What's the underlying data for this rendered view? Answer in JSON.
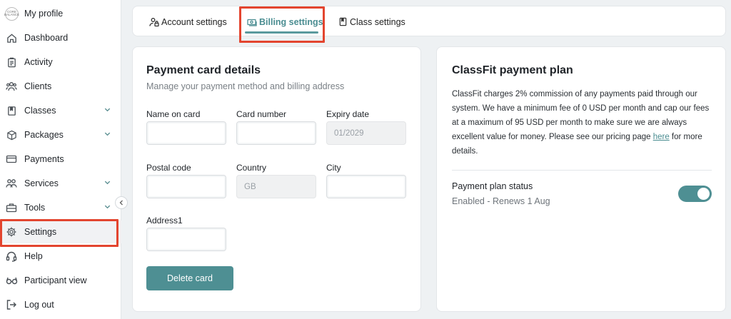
{
  "sidebar": {
    "avatar_text": "CORE BALANCE",
    "items": [
      {
        "label": "My profile"
      },
      {
        "label": "Dashboard"
      },
      {
        "label": "Activity"
      },
      {
        "label": "Clients"
      },
      {
        "label": "Classes"
      },
      {
        "label": "Packages"
      },
      {
        "label": "Payments"
      },
      {
        "label": "Services"
      },
      {
        "label": "Tools"
      },
      {
        "label": "Settings"
      },
      {
        "label": "Help"
      },
      {
        "label": "Participant view"
      },
      {
        "label": "Log out"
      }
    ]
  },
  "tabs": [
    {
      "label": "Account settings"
    },
    {
      "label": "Billing settings"
    },
    {
      "label": "Class settings"
    }
  ],
  "payment_card": {
    "title": "Payment card details",
    "subtitle": "Manage your payment method and billing address",
    "fields": {
      "name_on_card": {
        "label": "Name on card",
        "value": ""
      },
      "card_number": {
        "label": "Card number",
        "value": ""
      },
      "expiry_date": {
        "label": "Expiry date",
        "value": "01/2029"
      },
      "postal_code": {
        "label": "Postal code",
        "value": ""
      },
      "country": {
        "label": "Country",
        "value": "GB"
      },
      "city": {
        "label": "City",
        "value": ""
      },
      "address1": {
        "label": "Address1",
        "value": ""
      }
    },
    "delete_button": "Delete card"
  },
  "plan": {
    "title": "ClassFit payment plan",
    "description_before_link": "ClassFit charges 2% commission of any payments paid through our system. We have a minimum fee of 0 USD per month and cap our fees at a maximum of 95 USD per month to make sure we are always excellent value for money. Please see our pricing page ",
    "link_text": "here",
    "description_after_link": " for more details.",
    "status_label": "Payment plan status",
    "status_value": "Enabled - Renews 1 Aug",
    "toggle_on": true
  },
  "colors": {
    "accent": "#4e8f93",
    "highlight": "#e3452f"
  }
}
